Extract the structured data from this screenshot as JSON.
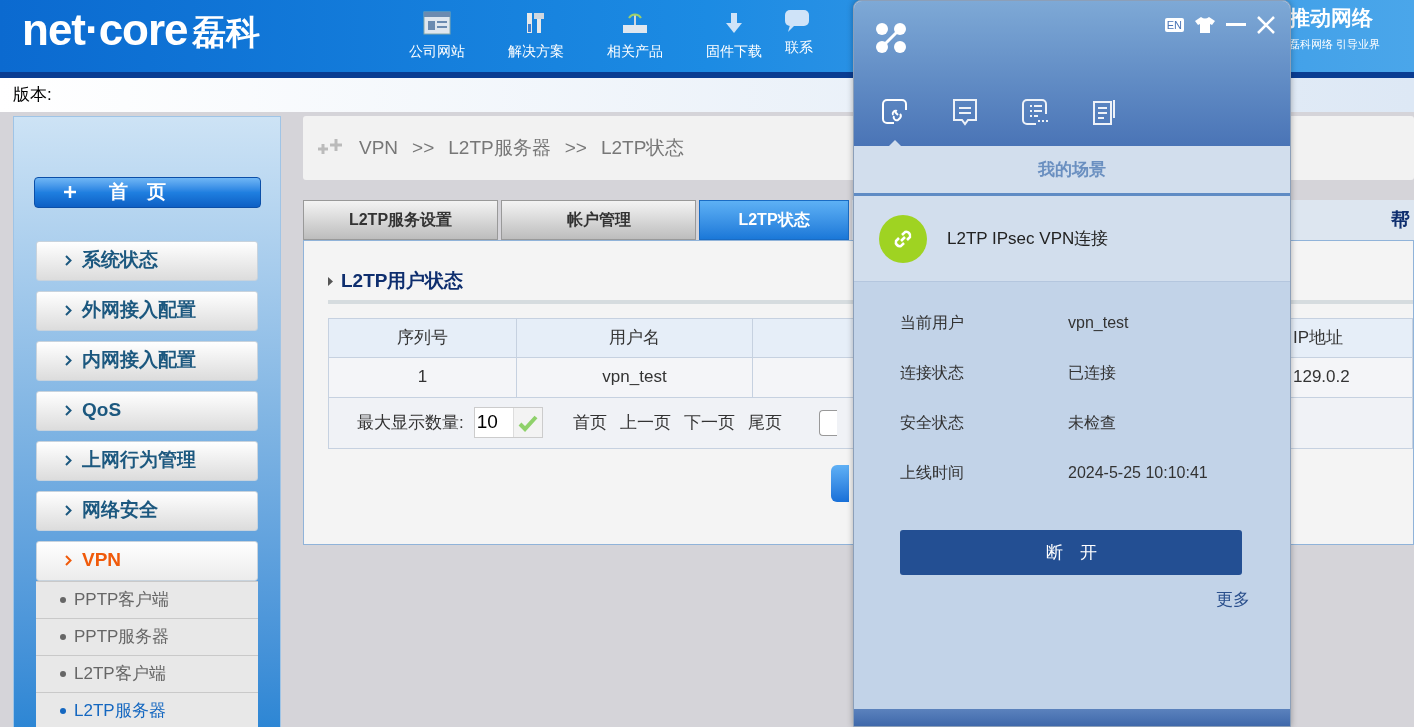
{
  "header": {
    "logo": "net·core",
    "logo_cn": "磊科",
    "nav": [
      {
        "label": "公司网站",
        "kind": "site"
      },
      {
        "label": "解决方案",
        "kind": "tools"
      },
      {
        "label": "相关产品",
        "kind": "router"
      },
      {
        "label": "固件下载",
        "kind": "download"
      },
      {
        "label": "联系",
        "kind": "chat"
      }
    ],
    "slogan": "推动网络",
    "tagline": "磊科网络 引导业界"
  },
  "version_label": "版本:",
  "sidebar": {
    "home": "首　页",
    "items": [
      {
        "label": "系统状态",
        "expanded": false
      },
      {
        "label": "外网接入配置",
        "expanded": false
      },
      {
        "label": "内网接入配置",
        "expanded": false
      },
      {
        "label": "QoS",
        "expanded": false
      },
      {
        "label": "上网行为管理",
        "expanded": false
      },
      {
        "label": "网络安全",
        "expanded": false
      },
      {
        "label": "VPN",
        "expanded": true,
        "children": [
          {
            "label": "PPTP客户端",
            "selected": false
          },
          {
            "label": "PPTP服务器",
            "selected": false
          },
          {
            "label": "L2TP客户端",
            "selected": false
          },
          {
            "label": "L2TP服务器",
            "selected": true
          }
        ]
      }
    ]
  },
  "breadcrumb": [
    "VPN",
    ">>",
    "L2TP服务器",
    ">>",
    "L2TP状态"
  ],
  "tabs": [
    {
      "label": "L2TP服务设置",
      "selected": false
    },
    {
      "label": "帐户管理",
      "selected": false
    },
    {
      "label": "L2TP状态",
      "selected": true
    }
  ],
  "help_tab": "帮",
  "section_title": "L2TP用户状态",
  "table": {
    "columns": [
      "序列号",
      "用户名",
      "IP地址"
    ],
    "rows": [
      [
        "1",
        "vpn_test",
        "129.0.2"
      ]
    ]
  },
  "pager": {
    "label": "最大显示数量:",
    "value": "10",
    "links": [
      "首页",
      "上一页",
      "下一页",
      "尾页"
    ]
  },
  "popup": {
    "tabs": [
      {
        "kind": "link",
        "selected": true
      },
      {
        "kind": "message",
        "selected": false
      },
      {
        "kind": "list",
        "selected": false
      },
      {
        "kind": "notes",
        "selected": false
      }
    ],
    "lang_button": "EN",
    "section": "我的场景",
    "scene": "L2TP IPsec VPN连接",
    "details": [
      {
        "label": "当前用户",
        "value": "vpn_test"
      },
      {
        "label": "连接状态",
        "value": "已连接"
      },
      {
        "label": "安全状态",
        "value": "未检查"
      },
      {
        "label": "上线时间",
        "value": "2024-5-25 10:10:41"
      }
    ],
    "disconnect": "断　开",
    "more": "更多"
  }
}
